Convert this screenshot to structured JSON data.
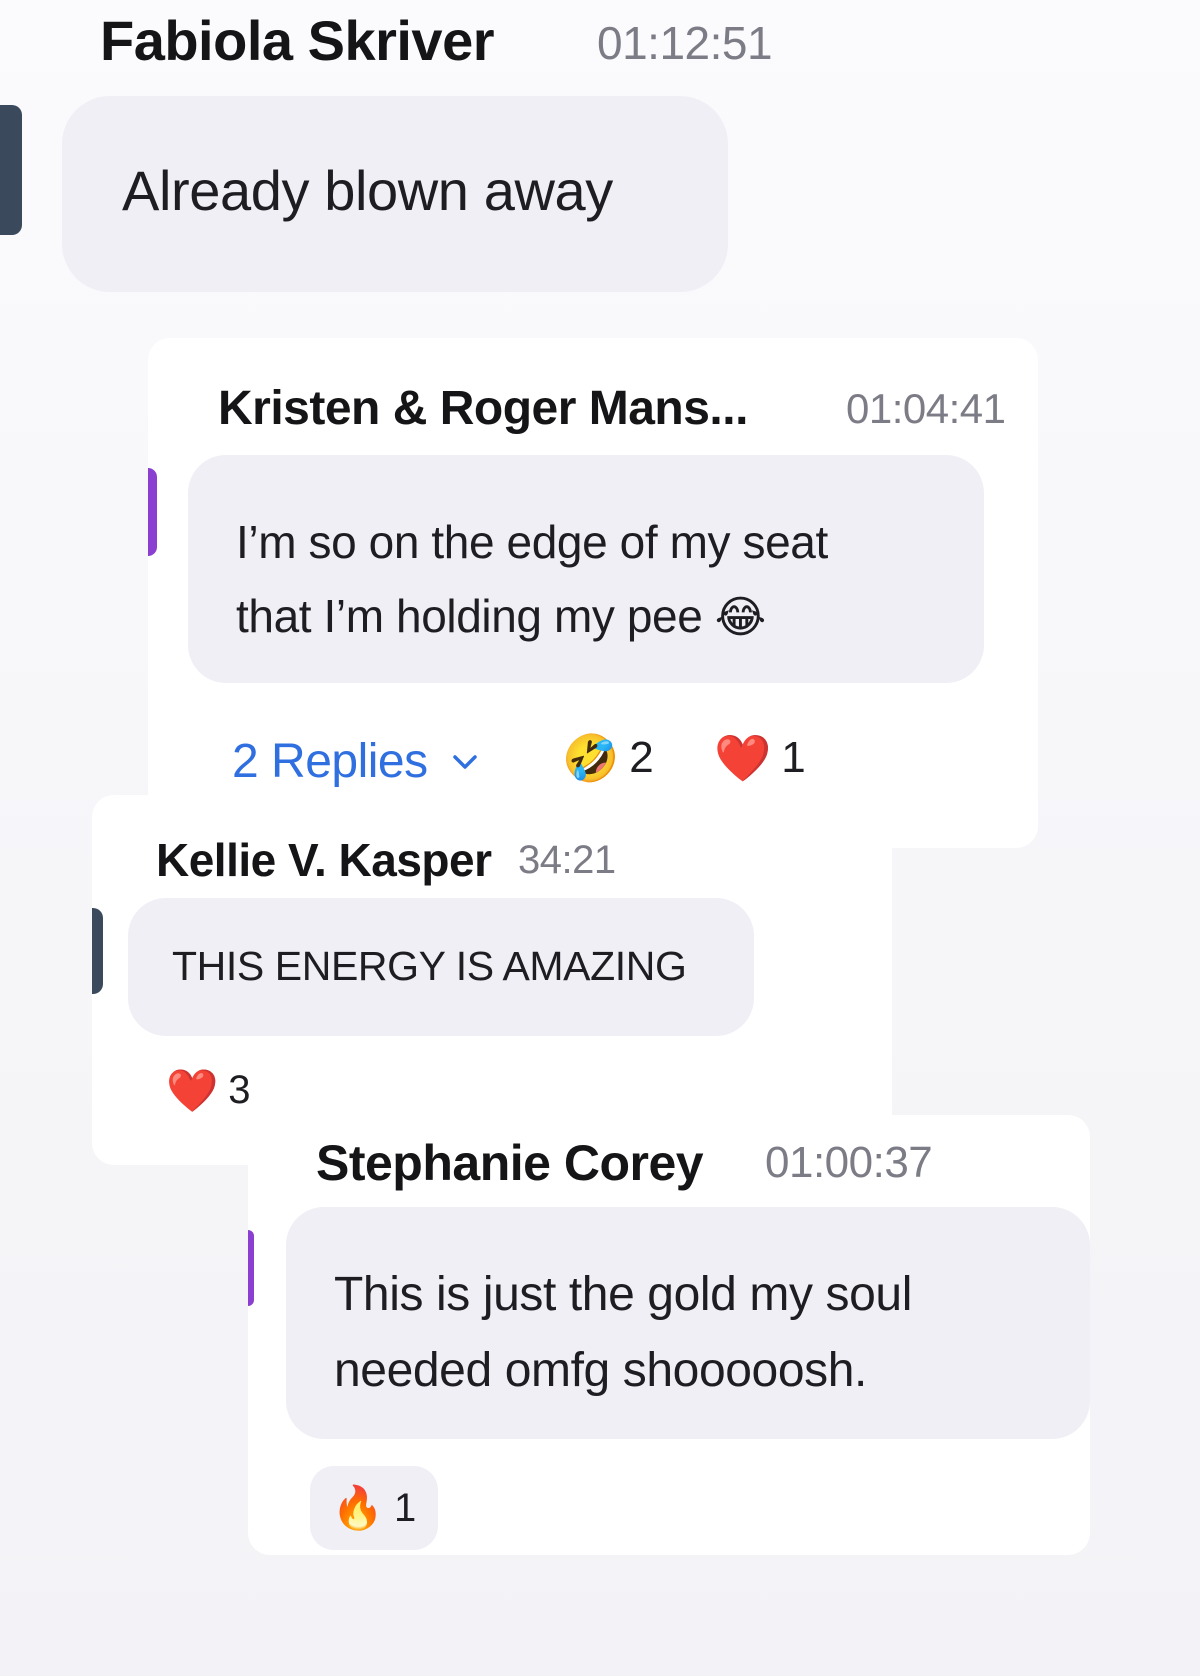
{
  "colors": {
    "accent_slate": "#3a4a5c",
    "accent_purple": "#8a3fd0",
    "replies_blue": "#2f6fe0",
    "bubble_bg": "#efeff5",
    "timestamp_gray": "#7c7c86"
  },
  "comments": [
    {
      "author": "Fabiola Skriver",
      "time": "01:12:51",
      "text": "Already blown away"
    },
    {
      "author": "Kristen & Roger Mans...",
      "time": "01:04:41",
      "text_line1": "I’m so on the edge of my seat",
      "text_line2": "that I’m holding my pee",
      "text_emoji": "😂",
      "replies_label": "2 Replies",
      "reactions": [
        {
          "emoji": "🤣",
          "icon": "rolling-laughing-emoji",
          "count": "2"
        },
        {
          "emoji": "❤️",
          "icon": "heart-emoji",
          "count": "1"
        }
      ]
    },
    {
      "author": "Kellie V. Kasper",
      "time": "34:21",
      "text": "THIS ENERGY IS AMAZING",
      "reactions": [
        {
          "emoji": "❤️",
          "icon": "heart-emoji",
          "count": "3"
        }
      ]
    },
    {
      "author": "Stephanie Corey",
      "time": "01:00:37",
      "text_line1": "This is just the gold my soul",
      "text_line2": "needed omfg shooooosh.",
      "reactions": [
        {
          "emoji": "🔥",
          "icon": "fire-emoji",
          "count": "1"
        }
      ]
    }
  ]
}
